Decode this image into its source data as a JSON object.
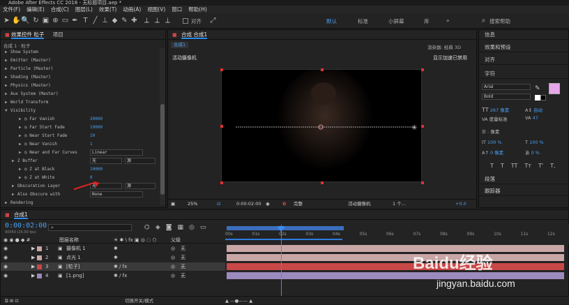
{
  "window": {
    "title": "Adobe After Effects CC 2018 - 无标题项目.aep *"
  },
  "menu": [
    "文件(F)",
    "编辑(E)",
    "合成(C)",
    "图层(L)",
    "效果(T)",
    "动画(A)",
    "视图(V)",
    "窗口",
    "帮助(H)"
  ],
  "toolbar": {
    "align_label": "对齐",
    "workspaces": [
      "默认",
      "标准",
      "小屏幕",
      "库"
    ],
    "search_label": "搜索帮助"
  },
  "effects_panel": {
    "tab": "效果控件 粒子",
    "tab2": "项目",
    "breadcrumb": "合成 1 · 粒子",
    "rows": [
      {
        "label": "Show System",
        "indent": 0
      },
      {
        "label": "Emitter (Master)",
        "indent": 0
      },
      {
        "label": "Particle (Master)",
        "indent": 0
      },
      {
        "label": "Shading (Master)",
        "indent": 0
      },
      {
        "label": "Physics (Master)",
        "indent": 0
      },
      {
        "label": "Aux System (Master)",
        "indent": 0
      },
      {
        "label": "World Transform",
        "indent": 0
      },
      {
        "label": "Visibility",
        "indent": 0,
        "open": true
      },
      {
        "label": "Far Vanish",
        "indent": 2,
        "value": "20000"
      },
      {
        "label": "Far Start Fade",
        "indent": 2,
        "value": "19000"
      },
      {
        "label": "Near Start Fade",
        "indent": 2,
        "value": "10"
      },
      {
        "label": "Near Vanish",
        "indent": 2,
        "value": "1"
      },
      {
        "label": "Near and Far Curves",
        "indent": 2,
        "select": "Linear"
      },
      {
        "label": "Z Buffer",
        "indent": 1,
        "select": "无",
        "select2": "源"
      },
      {
        "label": "Z at Black",
        "indent": 2,
        "value": "10000"
      },
      {
        "label": "Z at White",
        "indent": 2,
        "value": "0"
      },
      {
        "label": "Obscuration Layer",
        "indent": 1,
        "select": "无",
        "select2": "源"
      },
      {
        "label": "Also Obscure with",
        "indent": 1,
        "select": "None"
      },
      {
        "label": "Rendering",
        "indent": 0
      }
    ]
  },
  "comp_panel": {
    "tab": "合成 合成1",
    "tab2": "合成1",
    "renderer": "渲染器:",
    "renderer_val": "经典 3D",
    "camera": "活动摄像机",
    "accel": "显示加速已禁用",
    "bottom": {
      "zoom": "25%",
      "time": "0:00:02:00",
      "quality": "完整",
      "view": "活动摄像机",
      "views": "1 个...",
      "exposure": "+0.0"
    }
  },
  "right_panel": {
    "items": [
      "信息",
      "效果和预设",
      "对齐",
      "字符"
    ],
    "font": "Arial",
    "style": "Bold",
    "size": "267 像素",
    "leading": "自动",
    "kern": "度量标准",
    "track": "47",
    "stroke": "像素",
    "vscale": "100 %",
    "hscale": "100 %",
    "baseline": "0 像素",
    "tsume": "0 %",
    "typebtns": [
      "T",
      "T",
      "TT",
      "Tт",
      "T'",
      "T,"
    ],
    "bottom_items": [
      "段落",
      "跟踪器"
    ]
  },
  "timeline": {
    "tab": "合成1",
    "time": "0:00:02:00",
    "frames": "00050 (25.00 fps)",
    "cols": {
      "name": "图层名称",
      "parent": "父级"
    },
    "ruler": [
      "00s",
      "01s",
      "02s",
      "03s",
      "04s",
      "05s",
      "06s",
      "07s",
      "08s",
      "09s",
      "10s",
      "11s",
      "12s"
    ],
    "layers": [
      {
        "num": "1",
        "name": "摄像机 1",
        "parent": "无",
        "color": "#c9a6a6"
      },
      {
        "num": "2",
        "name": "点光 1",
        "parent": "无",
        "color": "#c9a6a6"
      },
      {
        "num": "3",
        "name": "[粒子]",
        "parent": "无",
        "color": "#c84747"
      },
      {
        "num": "4",
        "name": "[1.png]",
        "parent": "无",
        "color": "#9b8bbd"
      }
    ],
    "footer": "切换开关/模式"
  },
  "watermark": {
    "brand": "Baidu经验",
    "url": "jingyan.baidu.com"
  }
}
